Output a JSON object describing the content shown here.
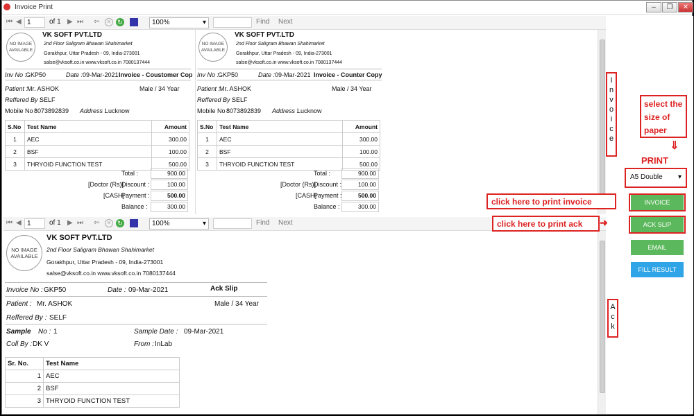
{
  "window": {
    "title": "Invoice Print"
  },
  "toolbar": {
    "page": "1",
    "of": "of 1",
    "zoom": "100%",
    "find": "Find",
    "next": "Next"
  },
  "company": {
    "name": "VK SOFT PVT.LTD",
    "address1": "2nd Floor Saligram Bhawan Shahimarket",
    "address2": "Gorakhpur, Uttar Pradesh - 09, India-273001",
    "contact": "salse@vksoft.co.in   www.vksoft.co.in  7080137444",
    "address2_ack": "Gorakhpur, Uttar Pradesh - 09, India-273001",
    "logo": "NO IMAGE AVAILABLE"
  },
  "invoice": {
    "inv_label": "Inv No :",
    "inv_no": "GKP50",
    "date_label": "Date :",
    "date": "09-Mar-2021",
    "copy_customer": "Invoice - Coustomer Copy",
    "copy_counter": "Invoice - Counter Copy",
    "patient_label": "Patient :",
    "patient": "Mr. ASHOK",
    "gender_age": "Male / 34 Year",
    "ref_label": "Reffered By :",
    "ref": "SELF",
    "mobile_label": "Mobile No :",
    "mobile": "8073892839",
    "address_label": "Address :",
    "address": "Lucknow",
    "headers": [
      "S.No",
      "Test Name",
      "Amount"
    ],
    "rows": [
      [
        "1",
        "AEC",
        "300.00"
      ],
      [
        "2",
        "BSF",
        "100.00"
      ],
      [
        "3",
        "THRYOID FUNCTION TEST",
        "500.00"
      ]
    ],
    "total_label": "Total :",
    "total": "900.00",
    "doctor_label": "[Doctor (Rs)]",
    "discount_label": "Discount :",
    "discount": "100.00",
    "cash_label": "[CASH]",
    "payment_label": "Payment :",
    "payment": "500.00",
    "balance_label": "Balance :",
    "balance": "300.00"
  },
  "ack": {
    "inv_label": "Invoice No :",
    "inv_no": "GKP50",
    "date_label": "Date :",
    "date": "09-Mar-2021",
    "title": "Ack Slip",
    "patient_label": "Patient :",
    "patient": "Mr. ASHOK",
    "gender_age": "Male / 34 Year",
    "ref_label": "Reffered By :",
    "ref": "SELF",
    "sample_label": "Sample",
    "no_label": "No :",
    "no": "1",
    "sample_date_label": "Sample Date :",
    "sample_date": "09-Mar-2021",
    "coll_label": "Coll By :",
    "coll": "DK V",
    "from_label": "From :",
    "from": "InLab",
    "headers": [
      "Sr. No.",
      "Test Name"
    ],
    "rows": [
      [
        "1",
        "AEC"
      ],
      [
        "2",
        "BSF"
      ],
      [
        "3",
        "THRYOID FUNCTION TEST"
      ]
    ]
  },
  "annotations": {
    "invoice_vertical": [
      "I",
      "n",
      "v",
      "o",
      "i",
      "c",
      "e"
    ],
    "ack_vertical": [
      "A",
      "c",
      "k"
    ],
    "select_size": "select the size of paper",
    "print": "PRINT",
    "click_invoice": "click here to print invoice",
    "click_ack": "click here to print ack"
  },
  "side": {
    "paper_size": "A5 Double",
    "invoice_btn": "INVOICE",
    "ack_btn": "ACK SLIP",
    "email_btn": "EMAIL",
    "fill_btn": "FILL RESULT",
    "colors": {
      "green": "#5cb85c",
      "blue": "#2fa4e7",
      "red": "#d22222"
    }
  }
}
